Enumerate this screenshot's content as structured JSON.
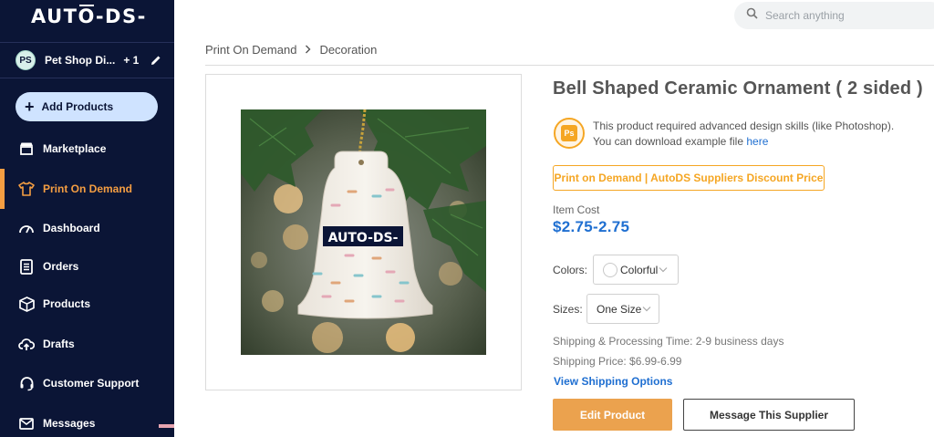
{
  "brand": {
    "logo_parts": [
      "AUT",
      "O",
      "-DS-"
    ],
    "accent_color": "#f59e42",
    "sidebar_bg": "#0b1536"
  },
  "store": {
    "initials": "PS",
    "name": "Pet Shop Di...",
    "extra_count": "+ 1",
    "edit_icon": "pencil-icon"
  },
  "sidebar": {
    "add_button_label": "Add Products",
    "items": [
      {
        "label": "Marketplace",
        "icon": "store-icon",
        "active": false
      },
      {
        "label": "Print On Demand",
        "icon": "tshirt-icon",
        "active": true
      },
      {
        "label": "Dashboard",
        "icon": "gauge-icon",
        "active": false
      },
      {
        "label": "Orders",
        "icon": "list-icon",
        "active": false
      },
      {
        "label": "Products",
        "icon": "box-icon",
        "active": false
      },
      {
        "label": "Drafts",
        "icon": "cloud-upload-icon",
        "active": false
      },
      {
        "label": "Customer Support",
        "icon": "headset-icon",
        "active": false
      },
      {
        "label": "Messages",
        "icon": "mail-icon",
        "active": false
      }
    ]
  },
  "search": {
    "placeholder": "Search anything",
    "value": ""
  },
  "breadcrumb": {
    "items": [
      "Print On Demand",
      "Decoration"
    ]
  },
  "product": {
    "title": "Bell Shaped Ceramic Ornament ( 2 sided )",
    "image_logo_text": "AUTO-DS-",
    "design_notice_line1": "This product required advanced design skills (like Photoshop).",
    "design_notice_line2_prefix": "You can download example file ",
    "design_notice_link": "here",
    "ps_badge": "Ps",
    "pod_tag": "Print on Demand | AutoDS Suppliers Discount Price",
    "item_cost_label": "Item Cost",
    "item_cost_value": "$2.75-2.75",
    "colors_label": "Colors:",
    "color_selected": "Colorful",
    "sizes_label": "Sizes:",
    "size_selected": "One Size",
    "shipping_processing": "Shipping & Processing Time: 2-9 business days",
    "shipping_price": "Shipping Price: $6.99-6.99",
    "view_shipping_link": "View Shipping Options",
    "edit_button": "Edit Product",
    "message_button": "Message This Supplier"
  }
}
